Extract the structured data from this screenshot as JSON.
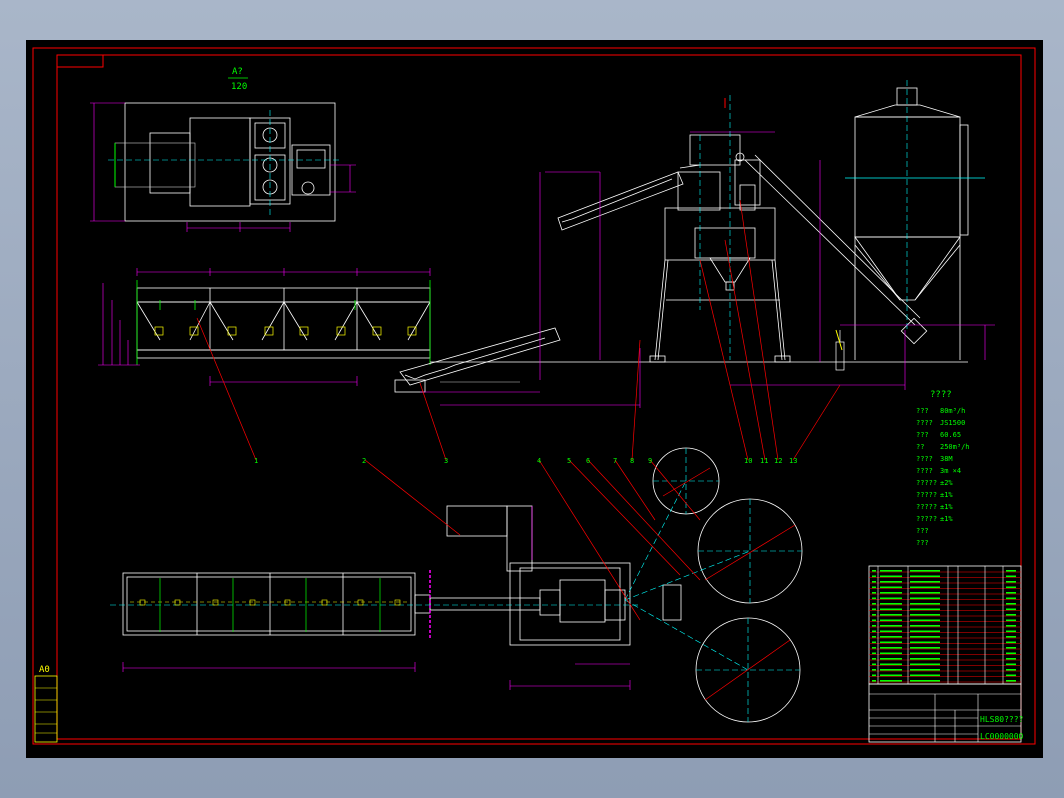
{
  "sheet": {
    "size_mark": "A0",
    "detail_scale_top": "A?",
    "detail_scale_bottom": "120"
  },
  "colors": {
    "paper": "#000000",
    "frame": "#ff0000",
    "outline": "#ffffff",
    "center": "#00ffff",
    "dims": "#ff00ff",
    "leader": "#ff0000",
    "text": "#00ff00",
    "yellow": "#ffff00"
  },
  "callouts": [
    "1",
    "2",
    "3",
    "4",
    "5",
    "6",
    "7",
    "8",
    "9",
    "10",
    "11",
    "12",
    "13"
  ],
  "specs": {
    "title": "????",
    "rows": [
      {
        "label": "???",
        "value": "80m³/h"
      },
      {
        "label": "????",
        "value": "JS1500"
      },
      {
        "label": "???",
        "value": "60.65"
      },
      {
        "label": "??",
        "value": "250m³/h"
      },
      {
        "label": "????",
        "value": "38M"
      },
      {
        "label": "????",
        "value": "3m ×4"
      },
      {
        "label": "?????",
        "value": "±2%"
      },
      {
        "label": "?????",
        "value": "±1%"
      },
      {
        "label": "?????",
        "value": "±1%"
      },
      {
        "label": "?????",
        "value": "±1%"
      },
      {
        "label": "???",
        "value": ""
      },
      {
        "label": "???",
        "value": ""
      }
    ]
  },
  "title_block": {
    "drawing_name": "HLS80????",
    "drawing_code": "LC0000000"
  }
}
